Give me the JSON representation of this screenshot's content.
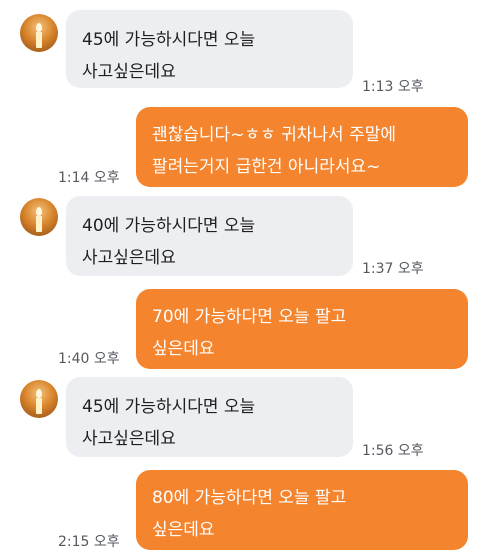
{
  "messages": [
    {
      "direction": "incoming",
      "text": "45에 가능하시다면 오늘\n사고싶은데요",
      "time": "1:13 오후"
    },
    {
      "direction": "outgoing",
      "text": "괜찮습니다~ㅎㅎ 귀차나서 주말에\n팔려는거지 급한건 아니라서요~",
      "time": "1:14 오후"
    },
    {
      "direction": "incoming",
      "text": "40에 가능하시다면 오늘\n사고싶은데요",
      "time": "1:37 오후"
    },
    {
      "direction": "outgoing",
      "text": "70에 가능하다면 오늘 팔고\n싶은데요",
      "time": "1:40 오후"
    },
    {
      "direction": "incoming",
      "text": "45에 가능하시다면 오늘\n사고싶은데요",
      "time": "1:56 오후"
    },
    {
      "direction": "outgoing",
      "text": "80에 가능하다면 오늘 팔고\n싶은데요",
      "time": "2:15 오후"
    }
  ],
  "colors": {
    "incoming_bubble": "#eceef2",
    "outgoing_bubble": "#f4842e",
    "outgoing_text": "#ffffff",
    "timestamp": "#555a60"
  },
  "icons": {
    "avatar": "candle-avatar-icon"
  }
}
